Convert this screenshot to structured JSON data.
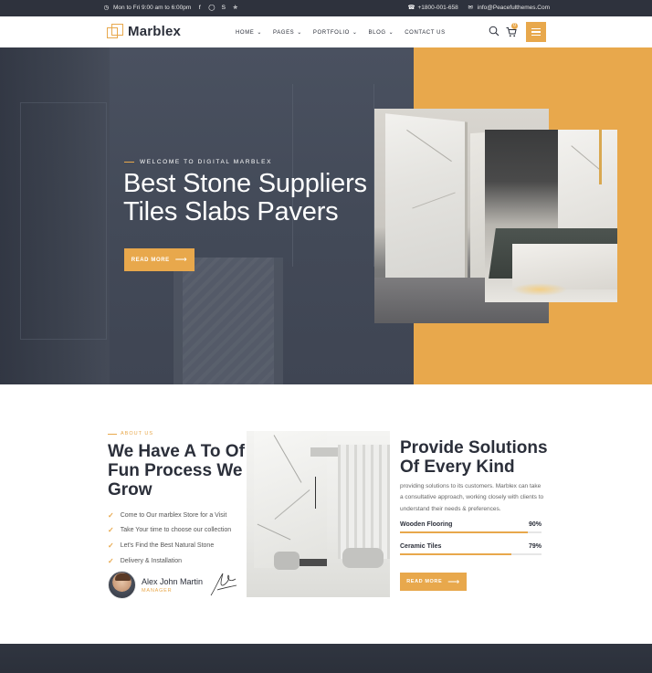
{
  "topbar": {
    "hours": "Mon to Fri 9:00 am to 6:00pm",
    "phone": "+1800-001-658",
    "email": "info@Peacefulthemes.Com",
    "social_icons": [
      "facebook-icon",
      "instagram-icon",
      "skype-icon",
      "twitter-icon"
    ]
  },
  "header": {
    "logo_text": "Marblex",
    "nav": [
      {
        "label": "HOME",
        "has_dropdown": true
      },
      {
        "label": "PAGES",
        "has_dropdown": true
      },
      {
        "label": "PORTFOLIO",
        "has_dropdown": true
      },
      {
        "label": "BLOG",
        "has_dropdown": true
      },
      {
        "label": "CONTACT US",
        "has_dropdown": false
      }
    ],
    "cart_count": "0",
    "accent_color": "#e8a84c"
  },
  "hero": {
    "eyebrow": "WELCOME TO DIGITAL MARBLEX",
    "title_line1": "Best Stone Suppliers",
    "title_line2": "Tiles Slabs Pavers",
    "button_label": "READ MORE"
  },
  "about": {
    "eyebrow": "ABOUT US",
    "title": "We Have A To Of Fun Process We Grow",
    "checklist": [
      "Come to Our marblex Store for a Visit",
      "Take Your time to choose our collection",
      "Let's Find the Best Natural Stone",
      "Delivery & Installation"
    ],
    "author_name": "Alex John Martin",
    "author_role": "MANAGER"
  },
  "solutions": {
    "title": "Provide Solutions Of Every Kind",
    "description": "providing solutions to its customers. Marblex can take a consultative approach, working closely with clients to understand their needs & preferences.",
    "skills": [
      {
        "label": "Wooden Flooring",
        "value": "90%",
        "fraction": 0.9
      },
      {
        "label": "Ceramic Tiles",
        "value": "79%",
        "fraction": 0.79
      }
    ],
    "button_label": "READ MORE"
  }
}
